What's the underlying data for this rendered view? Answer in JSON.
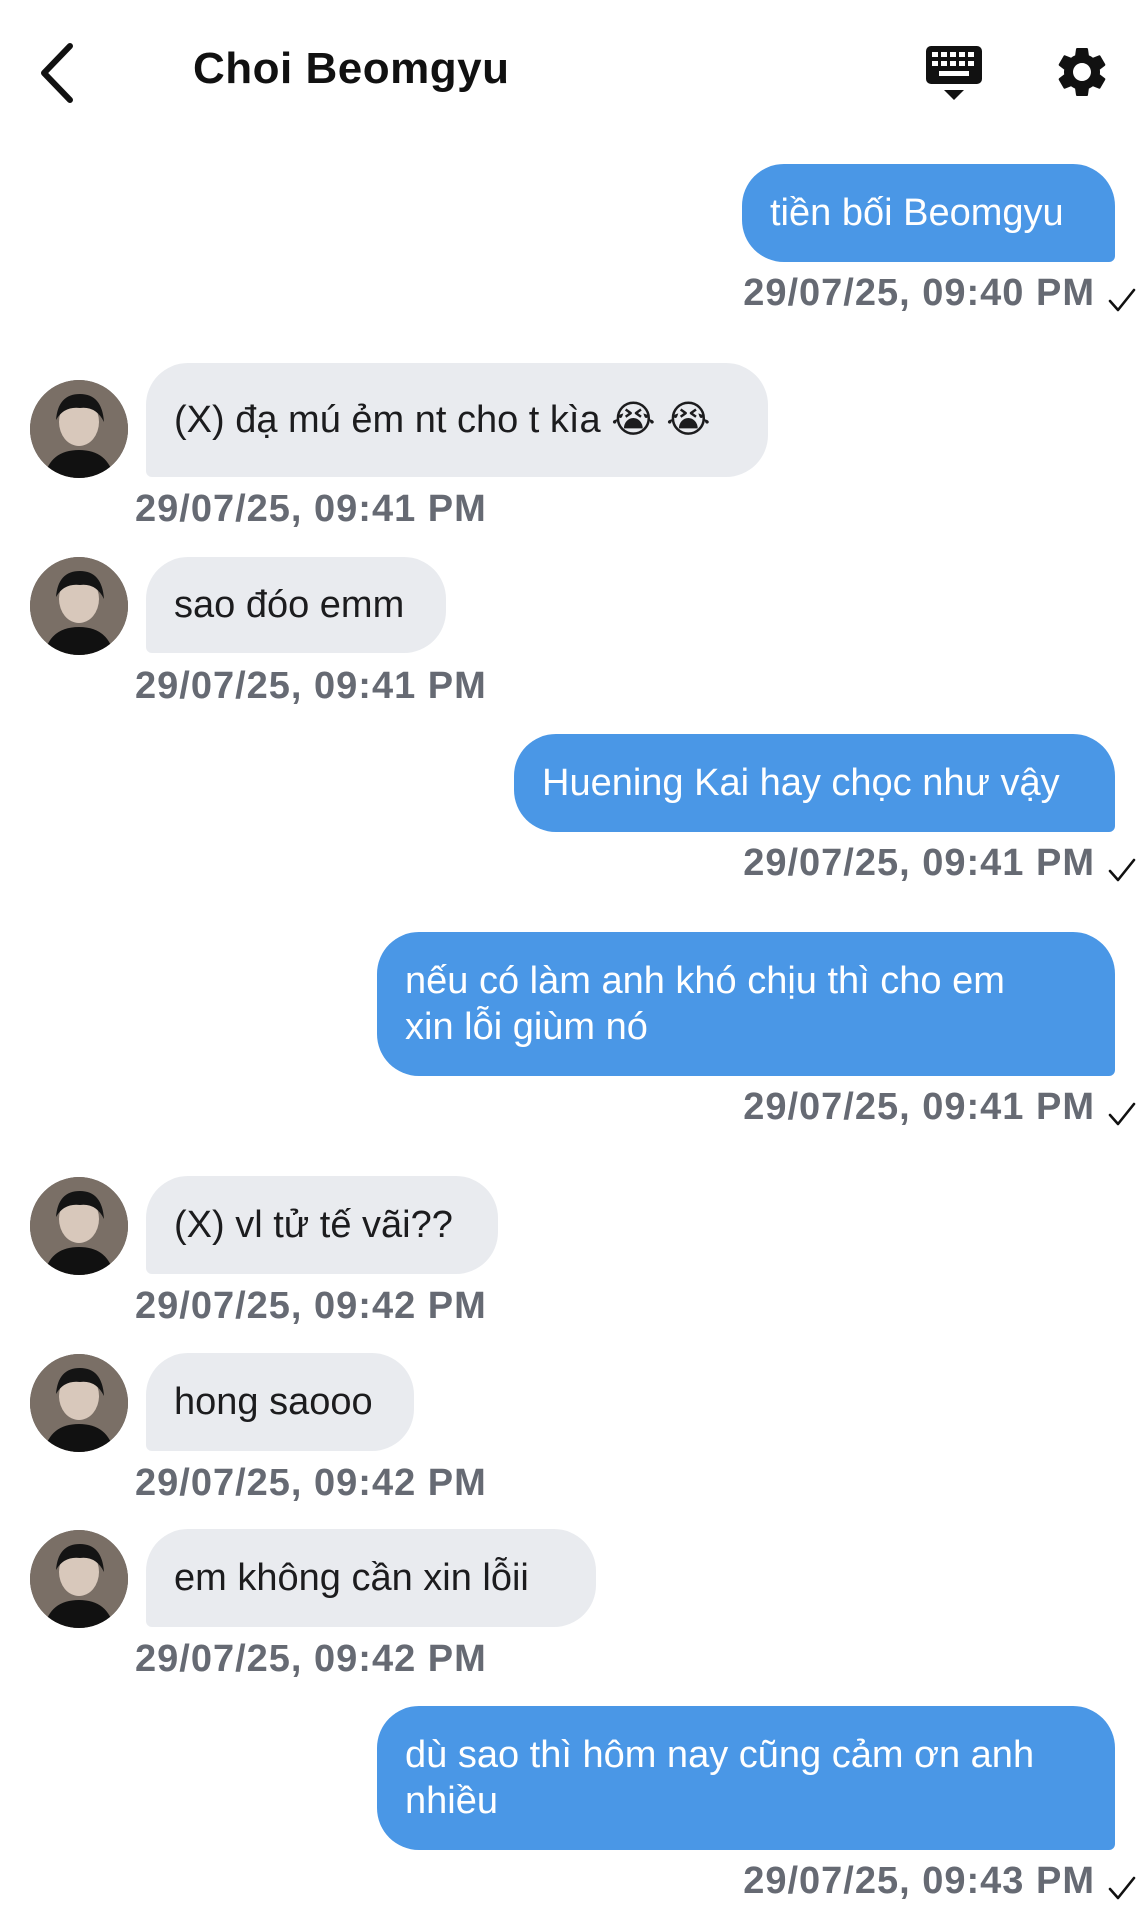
{
  "header": {
    "title": "Choi Beomgyu",
    "back_icon": "chevron-left-icon",
    "keyboard_icon": "keyboard-icon",
    "settings_icon": "gear-icon"
  },
  "colors": {
    "outgoing_bubble": "#4a97e6",
    "incoming_bubble": "#e9ebef",
    "timestamp": "#666a73"
  },
  "messages": [
    {
      "direction": "out",
      "text": "tiền bối Beomgyu",
      "time": "29/07/25, 09:40 PM",
      "read": true
    },
    {
      "direction": "in",
      "text": "(X) đạ mú ẻm nt cho t kìa 😭 😭",
      "time": "29/07/25, 09:41 PM"
    },
    {
      "direction": "in",
      "text": "sao đóo emm",
      "time": "29/07/25, 09:41 PM"
    },
    {
      "direction": "out",
      "text": "Huening Kai hay chọc như vậy",
      "time": "29/07/25, 09:41 PM",
      "read": true
    },
    {
      "direction": "out",
      "text": "nếu có làm anh khó chịu thì cho em\nxin lỗi giùm nó",
      "time": "29/07/25, 09:41 PM",
      "read": true
    },
    {
      "direction": "in",
      "text": "(X) vl tử tế vãi??",
      "time": "29/07/25, 09:42 PM"
    },
    {
      "direction": "in",
      "text": "hong saooo",
      "time": "29/07/25, 09:42 PM"
    },
    {
      "direction": "in",
      "text": "em không cần xin lỗii",
      "time": "29/07/25, 09:42 PM"
    },
    {
      "direction": "out",
      "text": "dù sao thì hôm nay cũng cảm ơn anh\nnhiều",
      "time": "29/07/25, 09:43 PM",
      "read": true
    }
  ]
}
